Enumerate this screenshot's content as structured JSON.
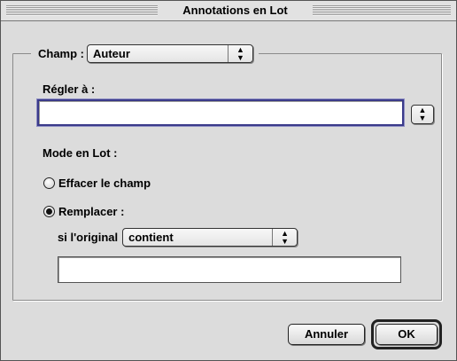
{
  "window": {
    "title": "Annotations en Lot"
  },
  "champ": {
    "label": "Champ :",
    "value": "Auteur"
  },
  "set_to": {
    "label": "Régler à :",
    "value": ""
  },
  "batch_mode": {
    "label": "Mode en Lot :",
    "options": [
      {
        "label": "Effacer le champ",
        "selected": false
      },
      {
        "label": "Remplacer :",
        "selected": true
      }
    ],
    "condition_label": "si l'original",
    "condition_value": "contient",
    "condition_text": ""
  },
  "buttons": {
    "cancel": "Annuler",
    "ok": "OK"
  },
  "icons": {
    "popup_arrows": "up-down-arrows-icon",
    "radio": "radio-button-icon"
  }
}
